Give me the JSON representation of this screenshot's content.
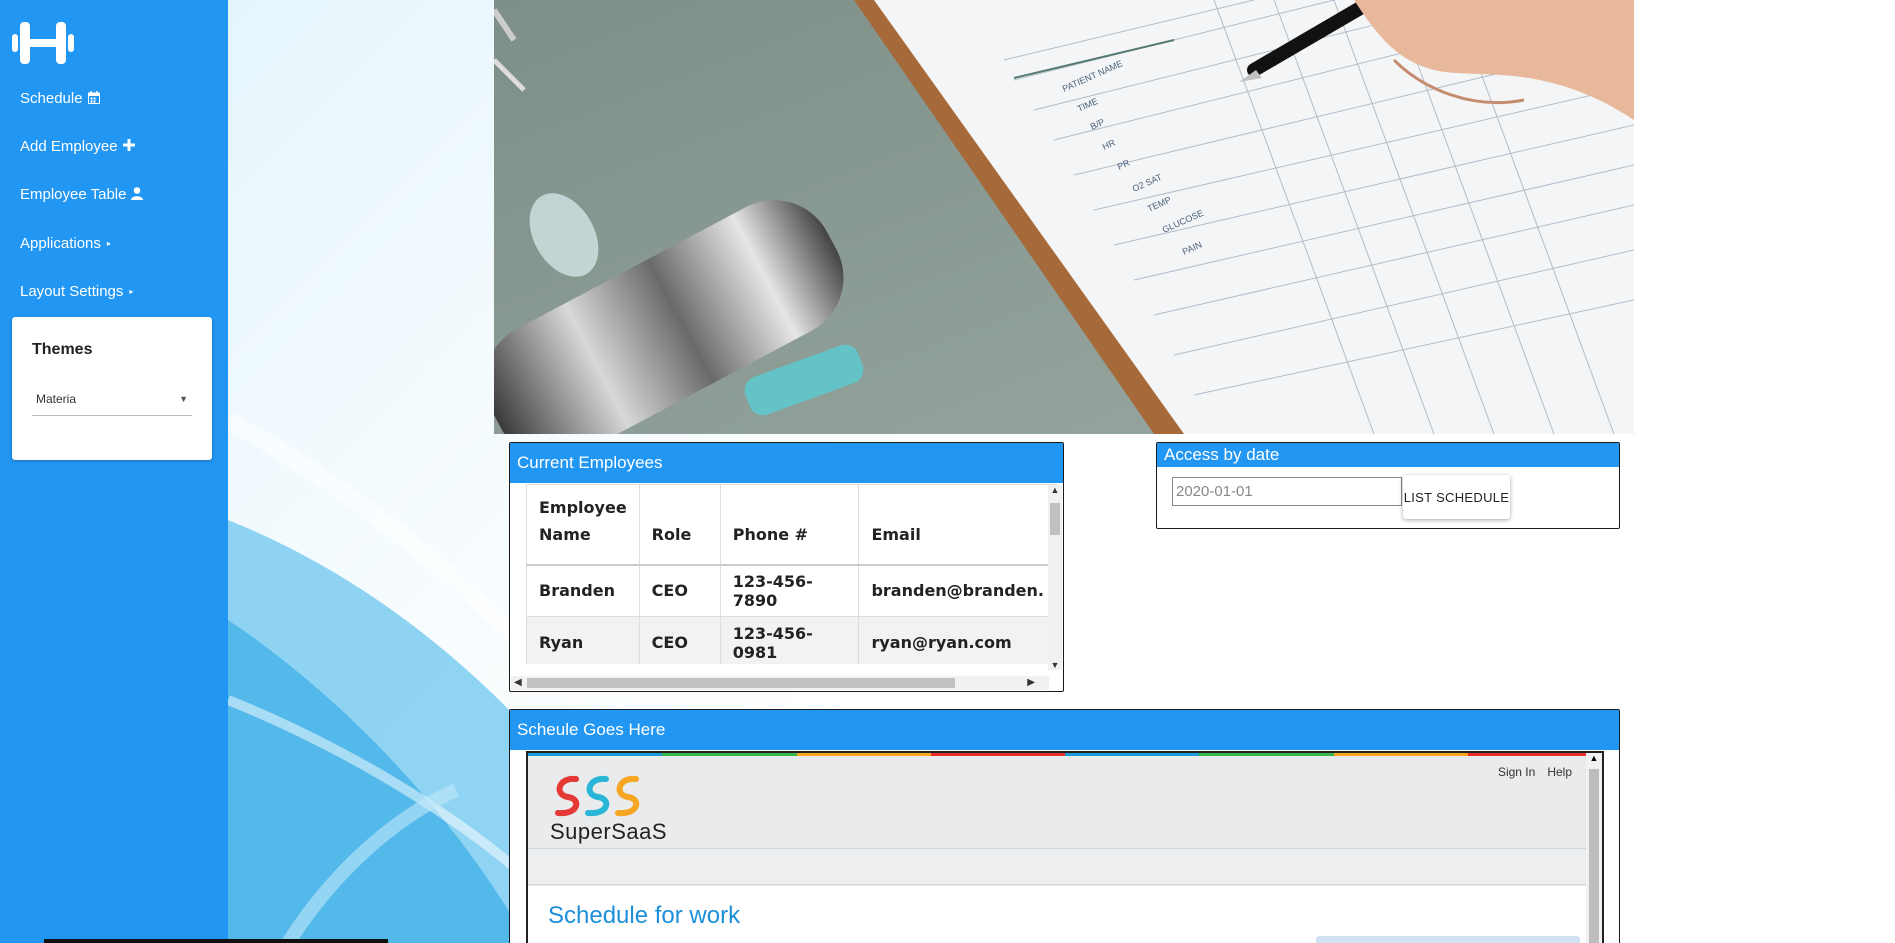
{
  "sidebar": {
    "items": [
      {
        "label": "Schedule",
        "icon": "calendar-icon"
      },
      {
        "label": "Add Employee",
        "icon": "plus-icon"
      },
      {
        "label": "Employee Table",
        "icon": "user-icon"
      },
      {
        "label": "Applications",
        "icon": "caret-right-icon"
      },
      {
        "label": "Layout Settings",
        "icon": "caret-right-icon"
      }
    ],
    "themes": {
      "title": "Themes",
      "selected": "Materia"
    }
  },
  "employees": {
    "title": "Current Employees",
    "columns": [
      "Employee Name",
      "Role",
      "Phone #",
      "Email"
    ],
    "rows": [
      [
        "Branden",
        "CEO",
        "123-456-7890",
        "branden@branden."
      ],
      [
        "Ryan",
        "CEO",
        "123-456-0981",
        "ryan@ryan.com"
      ]
    ]
  },
  "access": {
    "title": "Access by date",
    "date_value": "2020-01-01",
    "button_label": "LIST SCHEDULE"
  },
  "schedule": {
    "title": "Scheule Goes Here",
    "embed": {
      "sign_in": "Sign In",
      "help": "Help",
      "logo_text": "SuperSaaS",
      "heading": "Schedule for work"
    }
  },
  "colors": {
    "primary": "#2196f3",
    "embed_heading": "#1d8fd8"
  }
}
